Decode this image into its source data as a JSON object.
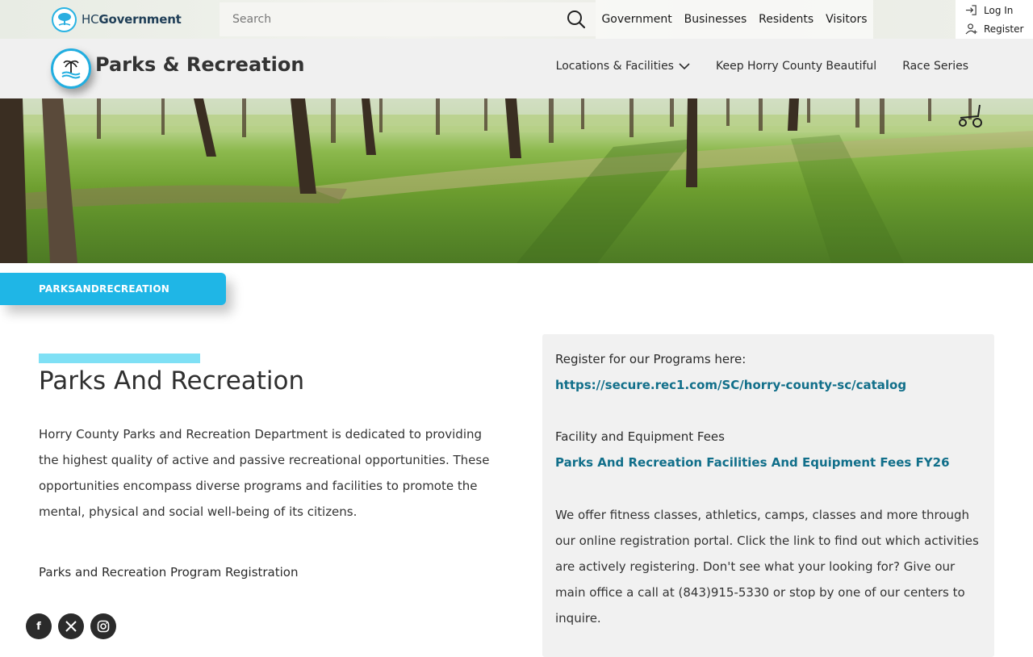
{
  "brand": {
    "prefix": "HC",
    "name": "Government"
  },
  "search": {
    "placeholder": "Search"
  },
  "top_nav": [
    "Government",
    "Businesses",
    "Residents",
    "Visitors"
  ],
  "account": {
    "login": "Log In",
    "register": "Register"
  },
  "department": {
    "title": "Parks & Recreation",
    "nav": [
      {
        "label": "Locations & Facilities",
        "has_dropdown": true
      },
      {
        "label": "Keep Horry County Beautiful"
      },
      {
        "label": "Race Series"
      }
    ]
  },
  "breadcrumb": "PARKSANDRECREATION",
  "main": {
    "title": "Parks And Recreation",
    "intro": "Horry County Parks and Recreation Department is dedicated to providing the highest quality of active and passive recreational opportunities. These opportunities encompass diverse programs and facilities to promote the mental, physical and social well-being of its citizens.",
    "registration_heading": "Parks and Recreation Program Registration"
  },
  "panel": {
    "register_text": "Register for our Programs here:",
    "register_link": "https://secure.rec1.com/SC/horry-county-sc/catalog",
    "fees_heading": "Facility and Equipment Fees",
    "fees_link": "Parks And Recreation Facilities And Equipment Fees FY26",
    "body": "We offer fitness classes, athletics, camps, classes and more through our online registration portal. Click the link to find out which activities are actively registering. Don't see what your looking for? Give our main office a call at (843)915-5330 or stop by one of our centers to inquire."
  },
  "social": [
    {
      "icon": "facebook-icon",
      "glyph": "f"
    },
    {
      "icon": "x-icon",
      "glyph": "X"
    },
    {
      "icon": "instagram-icon",
      "glyph": ""
    }
  ],
  "colors": {
    "accent": "#1fb6e6",
    "link": "#116f8a",
    "accent_light": "#7fe0f5",
    "panel_bg": "#f1f1f1"
  }
}
